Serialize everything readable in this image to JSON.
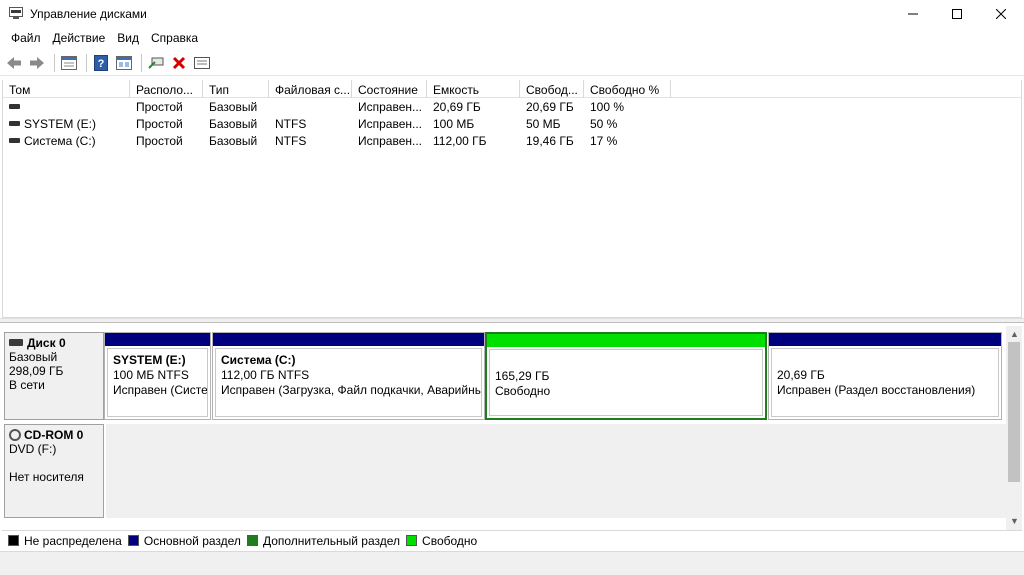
{
  "window": {
    "title": "Управление дисками",
    "icon": "disk-management-icon"
  },
  "menu": [
    "Файл",
    "Действие",
    "Вид",
    "Справка"
  ],
  "toolbar": [
    "back-arrow-icon",
    "forward-arrow-icon",
    "properties-icon",
    "help-icon",
    "view-icon",
    "connect-icon",
    "delete-icon",
    "list-icon"
  ],
  "volume_table": {
    "columns": [
      "Том",
      "Располо...",
      "Тип",
      "Файловая с...",
      "Состояние",
      "Емкость",
      "Свобод...",
      "Свободно %"
    ],
    "rows": [
      [
        "",
        "Простой",
        "Базовый",
        "",
        "Исправен...",
        "20,69 ГБ",
        "20,69 ГБ",
        "100 %"
      ],
      [
        "SYSTEM (E:)",
        "Простой",
        "Базовый",
        "NTFS",
        "Исправен...",
        "100 МБ",
        "50 МБ",
        "50 %"
      ],
      [
        "Система (C:)",
        "Простой",
        "Базовый",
        "NTFS",
        "Исправен...",
        "112,00 ГБ",
        "19,46 ГБ",
        "17 %"
      ]
    ]
  },
  "disks": [
    {
      "name": "Диск 0",
      "type": "Базовый",
      "size": "298,09 ГБ",
      "status": "В сети",
      "partitions": [
        {
          "name": "SYSTEM (E:)",
          "size": "100 МБ NTFS",
          "status": "Исправен (Систем"
        },
        {
          "name": "Система (C:)",
          "size": "112,00 ГБ NTFS",
          "status": "Исправен (Загрузка, Файл подкачки, Аварийный"
        },
        {
          "name": "",
          "size": "165,29 ГБ",
          "status": "Свободно"
        },
        {
          "name": "",
          "size": "20,69 ГБ",
          "status": "Исправен (Раздел восстановления)"
        }
      ]
    },
    {
      "name": "CD-ROM 0",
      "type": "DVD (F:)",
      "size": "",
      "status": "Нет носителя"
    }
  ],
  "legend": [
    {
      "label": "Не распределена",
      "color": "#000000"
    },
    {
      "label": "Основной раздел",
      "color": "#00007f"
    },
    {
      "label": "Дополнительный раздел",
      "color": "#1e7e1e"
    },
    {
      "label": "Свободно",
      "color": "#00e000"
    }
  ]
}
